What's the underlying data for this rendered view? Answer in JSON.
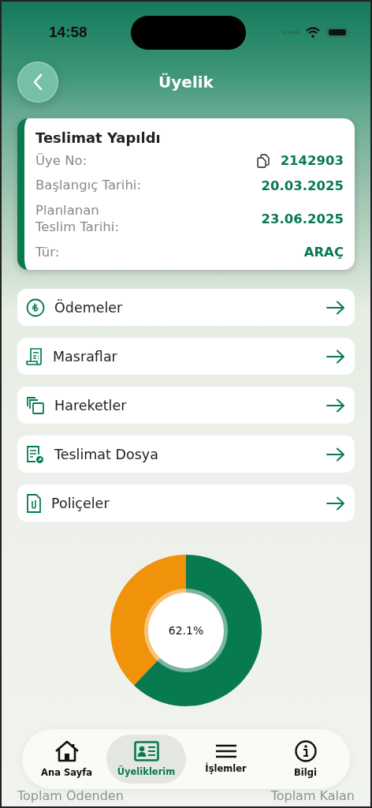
{
  "status_bar": {
    "time": "14:58"
  },
  "header": {
    "title": "Üyelik"
  },
  "membership_card": {
    "title": "Teslimat Yapıldı",
    "fields": [
      {
        "label": "Üye No:",
        "value": "2142903",
        "copyable": true
      },
      {
        "label": "Başlangıç Tarihi:",
        "value": "20.03.2025",
        "copyable": false
      },
      {
        "label": "Planlanan\nTeslim Tarihi:",
        "value": "23.06.2025",
        "copyable": false
      },
      {
        "label": "Tür:",
        "value": "ARAÇ",
        "copyable": false
      }
    ]
  },
  "menu": [
    {
      "kind": "lira",
      "label": "Ödemeler"
    },
    {
      "kind": "receipt",
      "label": "Masraflar"
    },
    {
      "kind": "copies",
      "label": "Hareketler"
    },
    {
      "kind": "document",
      "label": "Teslimat Dosya"
    },
    {
      "kind": "clip",
      "label": "Poliçeler"
    }
  ],
  "progress": {
    "chart_data": {
      "type": "donut",
      "categories": [
        "Toplam Ödenden",
        "Toplam Kalan"
      ],
      "values": [
        62.1,
        37.9
      ]
    },
    "center_label": "62.1%"
  },
  "tab_bar": [
    {
      "kind": "home",
      "label": "Ana Sayfa",
      "selected": false
    },
    {
      "kind": "card",
      "label": "Üyeliklerim",
      "selected": true
    },
    {
      "kind": "menu",
      "label": "İşlemler",
      "selected": false
    },
    {
      "kind": "info",
      "label": "Bilgi",
      "selected": false
    }
  ]
}
